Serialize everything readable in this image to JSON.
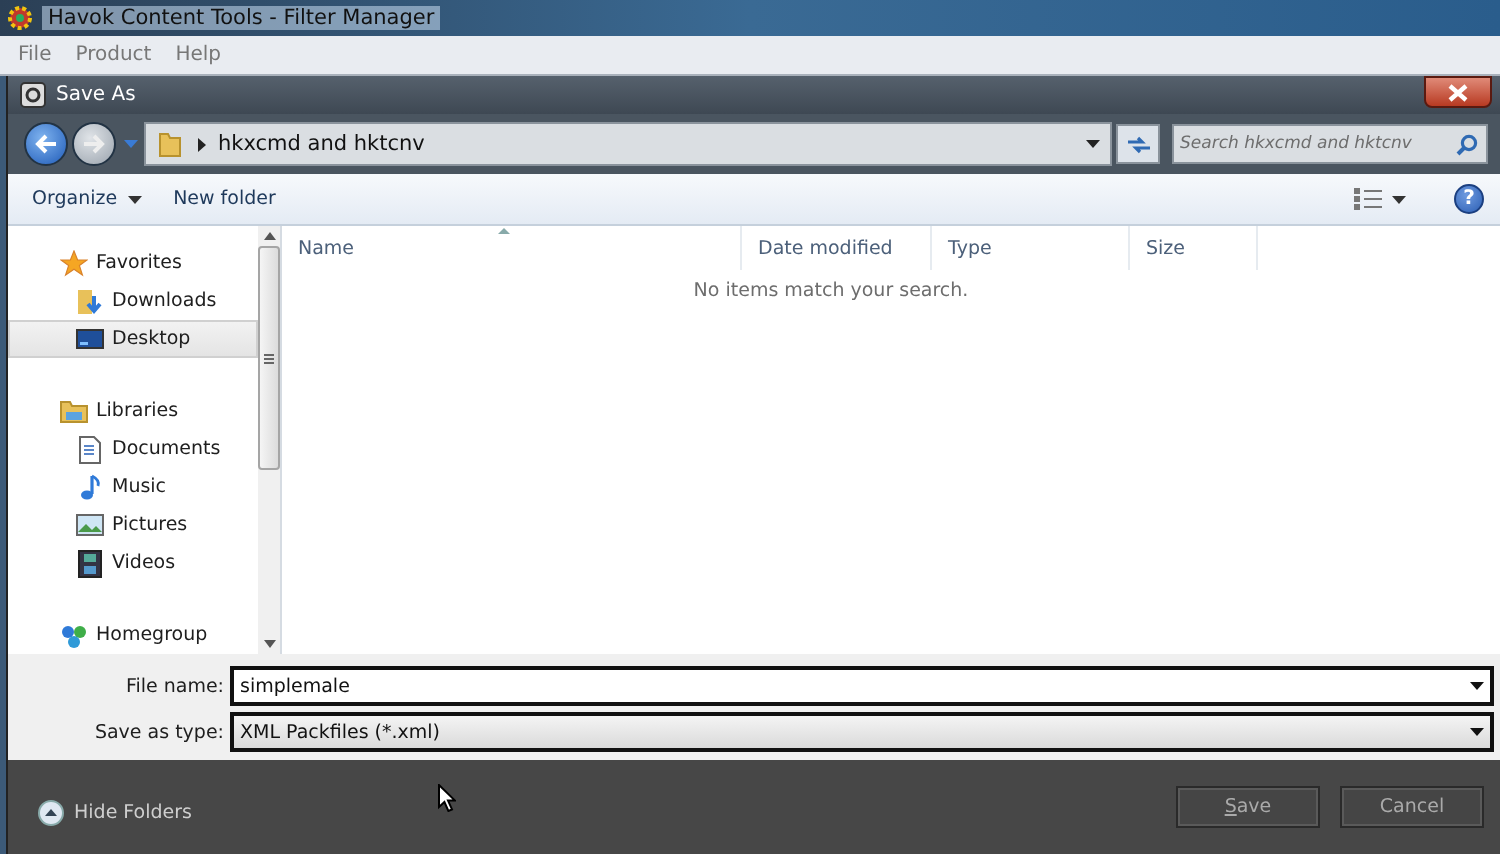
{
  "app_window": {
    "title": "Havok Content Tools - Filter Manager"
  },
  "menu_bar": [
    {
      "label": "File"
    },
    {
      "label": "Product"
    },
    {
      "label": "Help"
    }
  ],
  "dialog": {
    "title": "Save As"
  },
  "address_bar": {
    "path": "hkxcmd and hktcnv",
    "search_placeholder": "Search hkxcmd and hktcnv"
  },
  "toolbar": {
    "organize": "Organize",
    "new_folder": "New folder",
    "help": "?"
  },
  "nav_pane": [
    {
      "label": "Favorites",
      "kind": "star",
      "selected": false,
      "children": [
        {
          "label": "Downloads",
          "kind": "downloads",
          "selected": false
        },
        {
          "label": "Desktop",
          "kind": "desktop",
          "selected": true
        }
      ]
    },
    {
      "label": "Libraries",
      "kind": "libraries",
      "selected": false,
      "children": [
        {
          "label": "Documents",
          "kind": "documents",
          "selected": false
        },
        {
          "label": "Music",
          "kind": "music",
          "selected": false
        },
        {
          "label": "Pictures",
          "kind": "pictures",
          "selected": false
        },
        {
          "label": "Videos",
          "kind": "videos",
          "selected": false
        }
      ]
    },
    {
      "label": "Homegroup",
      "kind": "homegroup",
      "selected": false
    }
  ],
  "file_list": {
    "columns": [
      "Name",
      "Date modified",
      "Type",
      "Size"
    ],
    "empty_message": "No items match your search."
  },
  "file_name": {
    "label": "File name:",
    "value": "simplemale"
  },
  "save_as_type": {
    "label": "Save as type:",
    "value": "XML Packfiles (*.xml)"
  },
  "footer": {
    "hide_folders": "Hide Folders",
    "buttons": [
      "Save",
      "Cancel"
    ]
  }
}
